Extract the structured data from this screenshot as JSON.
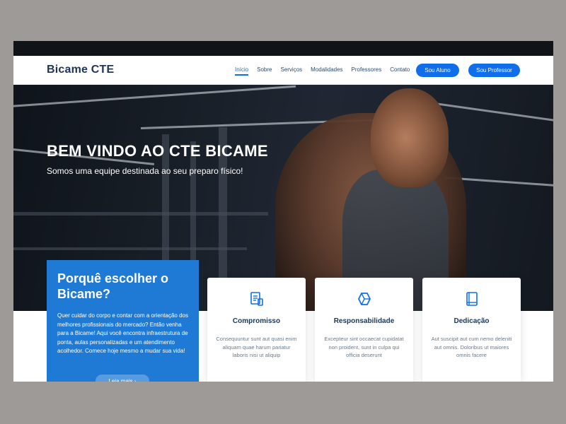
{
  "brand": {
    "name": "Bicame CTE",
    "accent": "#106eea"
  },
  "nav": {
    "items": [
      {
        "label": "Início",
        "active": true
      },
      {
        "label": "Sobre",
        "active": false
      },
      {
        "label": "Serviços",
        "active": false
      },
      {
        "label": "Modalidades",
        "active": false
      },
      {
        "label": "Professores",
        "active": false
      },
      {
        "label": "Contato",
        "active": false
      }
    ],
    "student_button": "Sou Aluno",
    "teacher_button": "Sou Professor"
  },
  "hero": {
    "title": "BEM VINDO AO CTE BICAME",
    "subtitle": "Somos uma equipe destinada ao seu preparo físico!"
  },
  "why": {
    "title": "Porquê escolher o Bicame?",
    "text": "Quer cuidar do corpo e contar com a orientação dos melhores profissionais do mercado? Então venha para a Bicame! Aqui você encontra infraestrutura de ponta, aulas personalizadas e um atendimento acolhedor. Comece hoje mesmo a mudar sua vida!",
    "button": "Leia mais ›"
  },
  "cards": [
    {
      "icon": "document-icon",
      "title": "Compromisso",
      "text": "Consequuntur sunt aut quasi enim aliquam quae harum pariatur laboris nisi ut aliquip"
    },
    {
      "icon": "cube-icon",
      "title": "Responsabilidade",
      "text": "Excepteur sint occaecat cupidatat non proident, sunt in culpa qui officia deserunt"
    },
    {
      "icon": "book-icon",
      "title": "Dedicação",
      "text": "Aut suscipit aut cum nemo deleniti aut omnis. Doloribus ut maiores omnis facere"
    }
  ]
}
